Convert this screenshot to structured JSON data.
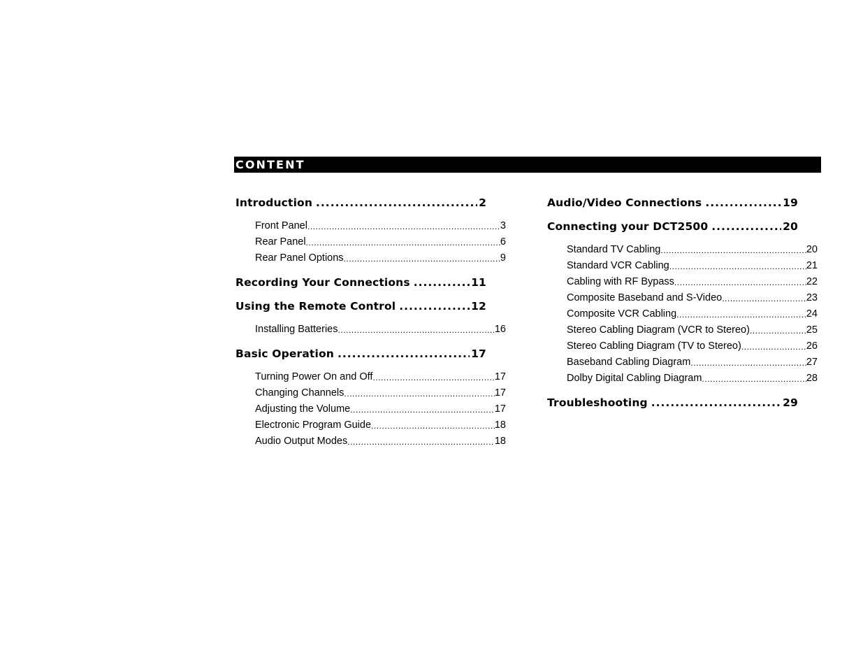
{
  "header": {
    "title": "CONTENT"
  },
  "columns": {
    "left": [
      {
        "level": 1,
        "label": "Introduction",
        "page": "2"
      },
      {
        "level": 2,
        "label": "Front Panel",
        "page": "3"
      },
      {
        "level": 2,
        "label": "Rear Panel",
        "page": "6"
      },
      {
        "level": 2,
        "label": "Rear Panel Options",
        "page": "9"
      },
      {
        "level": 1,
        "label": "Recording Your Connections",
        "page": "11"
      },
      {
        "level": 1,
        "label": "Using the Remote Control",
        "page": "12"
      },
      {
        "level": 2,
        "label": "Installing Batteries",
        "page": "16"
      },
      {
        "level": 1,
        "label": "Basic Operation",
        "page": "17"
      },
      {
        "level": 2,
        "label": "Turning Power On and Off",
        "page": "17"
      },
      {
        "level": 2,
        "label": "Changing Channels",
        "page": "17"
      },
      {
        "level": 2,
        "label": "Adjusting the Volume",
        "page": "17"
      },
      {
        "level": 2,
        "label": "Electronic Program Guide",
        "page": "18"
      },
      {
        "level": 2,
        "label": "Audio Output Modes",
        "page": "18"
      }
    ],
    "right": [
      {
        "level": 1,
        "label": "Audio/Video Connections",
        "page": "19"
      },
      {
        "level": 1,
        "label": "Connecting your DCT2500",
        "page": "20"
      },
      {
        "level": 2,
        "label": "Standard TV Cabling",
        "page": "20"
      },
      {
        "level": 2,
        "label": "Standard VCR Cabling",
        "page": "21"
      },
      {
        "level": 2,
        "label": "Cabling with RF Bypass",
        "page": "22"
      },
      {
        "level": 2,
        "label": "Composite Baseband and S-Video",
        "page": "23"
      },
      {
        "level": 2,
        "label": "Composite VCR Cabling",
        "page": "24"
      },
      {
        "level": 2,
        "label": "Stereo Cabling Diagram (VCR to Stereo)",
        "page": "25"
      },
      {
        "level": 2,
        "label": "Stereo Cabling Diagram (TV to Stereo)",
        "page": "26"
      },
      {
        "level": 2,
        "label": "Baseband Cabling Diagram",
        "page": "27"
      },
      {
        "level": 2,
        "label": "Dolby Digital Cabling Diagram",
        "page": "28"
      },
      {
        "level": 1,
        "label": "Troubleshooting",
        "page": "29"
      }
    ]
  },
  "colors": {
    "header_background": "#000000",
    "header_text": "#ffffff",
    "body_text": "#000000",
    "page_background": "#ffffff"
  }
}
